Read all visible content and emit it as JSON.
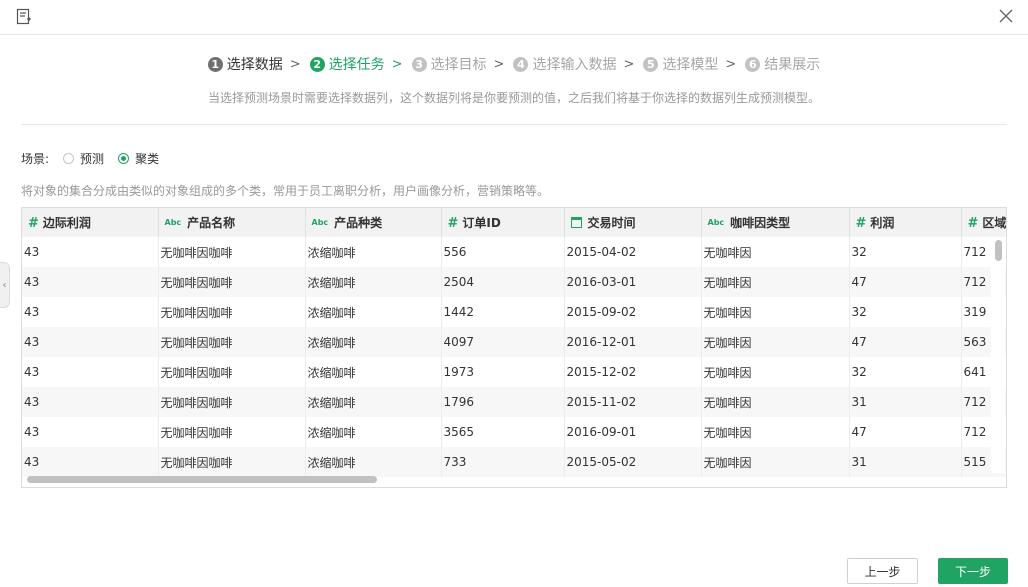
{
  "steps": [
    {
      "num": "1",
      "label": "选择数据",
      "state": "done"
    },
    {
      "num": "2",
      "label": "选择任务",
      "state": "active"
    },
    {
      "num": "3",
      "label": "选择目标",
      "state": "todo"
    },
    {
      "num": "4",
      "label": "选择输入数据",
      "state": "todo"
    },
    {
      "num": "5",
      "label": "选择模型",
      "state": "todo"
    },
    {
      "num": "6",
      "label": "结果展示",
      "state": "todo"
    }
  ],
  "hint": "当选择预测场景时需要选择数据列，这个数据列将是你要预测的值，之后我们将基于你选择的数据列生成预测模型。",
  "scene": {
    "label": "场景:",
    "options": [
      {
        "label": "预测",
        "checked": false
      },
      {
        "label": "聚类",
        "checked": true
      }
    ]
  },
  "description": "将对象的集合分成由类似的对象组成的多个类，常用于员工离职分析，用户画像分析，营销策略等。",
  "table": {
    "columns": [
      {
        "label": "边际利润",
        "icon": "number-icon"
      },
      {
        "label": "产品名称",
        "icon": "text-abc-icon"
      },
      {
        "label": "产品种类",
        "icon": "text-abc-icon"
      },
      {
        "label": "订单ID",
        "icon": "number-icon"
      },
      {
        "label": "交易时间",
        "icon": "calendar-icon"
      },
      {
        "label": "咖啡因类型",
        "icon": "text-abc-icon"
      },
      {
        "label": "利润",
        "icon": "number-icon"
      },
      {
        "label": "区域",
        "icon": "number-icon"
      }
    ],
    "rows": [
      [
        "43",
        "无咖啡因咖啡",
        "浓缩咖啡",
        "556",
        "2015-04-02",
        "无咖啡因",
        "32",
        "712"
      ],
      [
        "43",
        "无咖啡因咖啡",
        "浓缩咖啡",
        "2504",
        "2016-03-01",
        "无咖啡因",
        "47",
        "712"
      ],
      [
        "43",
        "无咖啡因咖啡",
        "浓缩咖啡",
        "1442",
        "2015-09-02",
        "无咖啡因",
        "32",
        "319"
      ],
      [
        "43",
        "无咖啡因咖啡",
        "浓缩咖啡",
        "4097",
        "2016-12-01",
        "无咖啡因",
        "47",
        "563"
      ],
      [
        "43",
        "无咖啡因咖啡",
        "浓缩咖啡",
        "1973",
        "2015-12-02",
        "无咖啡因",
        "32",
        "641"
      ],
      [
        "43",
        "无咖啡因咖啡",
        "浓缩咖啡",
        "1796",
        "2015-11-02",
        "无咖啡因",
        "31",
        "712"
      ],
      [
        "43",
        "无咖啡因咖啡",
        "浓缩咖啡",
        "3565",
        "2016-09-01",
        "无咖啡因",
        "47",
        "712"
      ],
      [
        "43",
        "无咖啡因咖啡",
        "浓缩咖啡",
        "733",
        "2015-05-02",
        "无咖啡因",
        "31",
        "515"
      ]
    ]
  },
  "buttons": {
    "prev": "上一步",
    "next": "下一步"
  },
  "colors": {
    "accent": "#1fa463"
  }
}
